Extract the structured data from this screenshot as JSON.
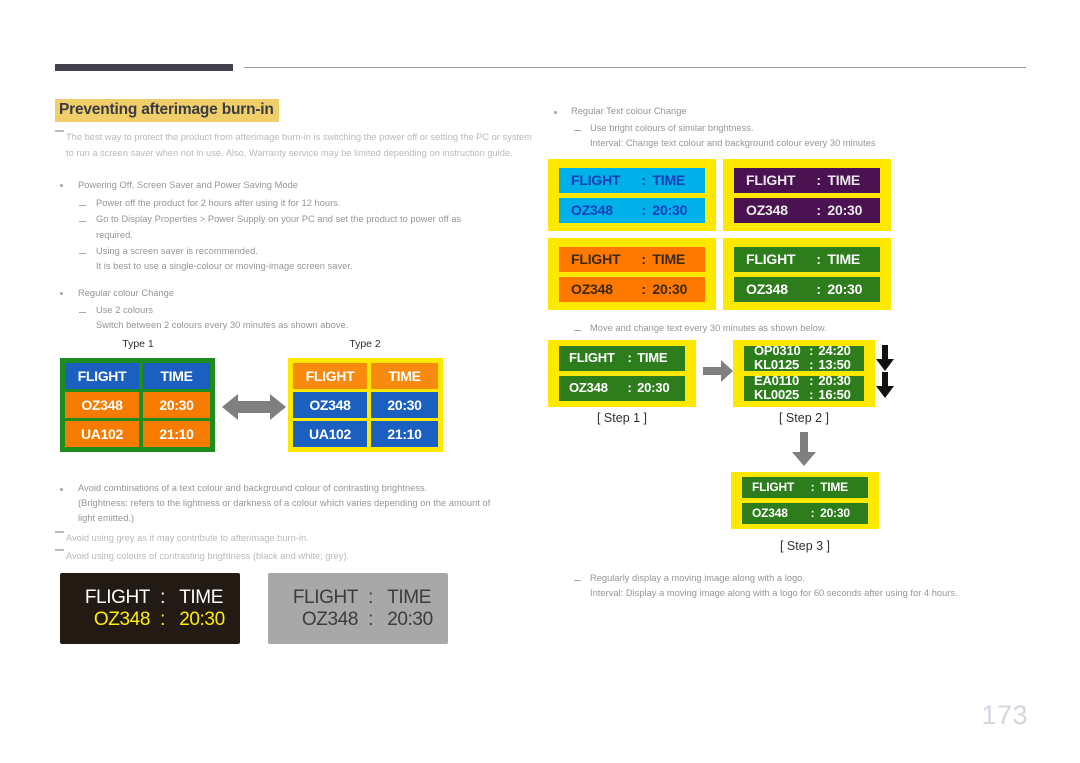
{
  "header": {
    "accent_color": "#45414f",
    "rule_color": "#9a9aa0"
  },
  "title": "Preventing afterimage burn-in",
  "title_highlight_color": "#f0cf6a",
  "left_column": {
    "intro_note": "The best way to protect the product from afterimage burn-in is switching the power off or setting the PC or system to run a screen saver when not in use. Also, Warranty service may be limited depending on instruction guide.",
    "bullet1": "Powering Off, Screen Saver and Power Saving Mode",
    "b1_sub1": "Power off the product for 2 hours after using it for 12 hours.",
    "b1_sub2": "Go to Display Properties > Power Supply on your PC and set the product to power off as required.",
    "b1_sub3": "Using a screen saver is recommended.",
    "b1_sub3_cont": "It is best to use a single-colour or moving-image screen saver.",
    "bullet2": "Regular colour Change",
    "b2_sub1": "Use 2 colours",
    "b2_sub1_cont": "Switch between 2 colours every 30 minutes as shown above.",
    "bullet3": "Avoid combinations of a text colour and background colour of contrasting brightness.",
    "bullet3_cont1": "(Brightness: refers to the lightness or darkness of a colour which varies depending on the amount of",
    "bullet3_cont2": "light emitted.)",
    "note1": "Avoid using grey as it may contribute to afterimage burn-in.",
    "note2": "Avoid using colours of contrasting brightness (black and white; grey)."
  },
  "right_column": {
    "bullet1": "Regular Text colour Change",
    "b1_sub1": "Use bright colours of similar brightness.",
    "b1_sub1_cont": "Interval: Change text colour and background colour every 30 minutes",
    "b1_sub2": "Move and change text every 30 minutes as shown below.",
    "b1_sub3": "Regularly display a moving image along with a logo.",
    "b1_sub3_cont": "Interval: Display a moving image along with a logo for 60 seconds after using for 4 hours."
  },
  "type_boards": [
    {
      "label": "Type 1",
      "border_color": "#1e8c1e",
      "header_bg": "#1b5fc0",
      "header_fg": "#ffffff",
      "body_bg": "#f57c00",
      "body_fg": "#ffffff",
      "rows": [
        [
          "FLIGHT",
          "TIME"
        ],
        [
          "OZ348",
          "20:30"
        ],
        [
          "UA102",
          "21:10"
        ]
      ]
    },
    {
      "label": "Type 2",
      "border_color": "#ffe800",
      "header_bg": "#f88a10",
      "header_fg": "#ffffff",
      "body_bg": "#1b5fc0",
      "body_fg": "#ffffff",
      "rows": [
        [
          "FLIGHT",
          "TIME"
        ],
        [
          "OZ348",
          "20:30"
        ],
        [
          "UA102",
          "21:10"
        ]
      ]
    }
  ],
  "swap_arrow": "double-headed-horizontal-arrow",
  "colour_panels": [
    {
      "name": "cyan-panel",
      "frame": "#ffe800",
      "bg": "#00b0e8",
      "fg": "#1540b8",
      "flight_label": "FLIGHT",
      "time_label": "TIME",
      "separator": ":",
      "flight_no": "OZ348",
      "flight_time": "20:30"
    },
    {
      "name": "purple-panel",
      "frame": "#ffe800",
      "bg": "#4b1252",
      "fg": "#e8e8e8",
      "flight_label": "FLIGHT",
      "time_label": "TIME",
      "separator": ":",
      "flight_no": "OZ348",
      "flight_time": "20:30"
    },
    {
      "name": "orange-panel",
      "frame": "#ffe800",
      "bg": "#ff7800",
      "fg": "#3a2a10",
      "flight_label": "FLIGHT",
      "time_label": "TIME",
      "separator": ":",
      "flight_no": "OZ348",
      "flight_time": "20:30"
    },
    {
      "name": "green-panel",
      "frame": "#ffe800",
      "bg": "#2d7d1c",
      "fg": "#ffffff",
      "flight_label": "FLIGHT",
      "time_label": "TIME",
      "separator": ":",
      "flight_no": "OZ348",
      "flight_time": "20:30"
    }
  ],
  "steps": {
    "step1": {
      "caption": "[ Step 1 ]",
      "frame": "#ffe800",
      "bg": "#2d7d1c",
      "fg": "#ffffff",
      "line1": {
        "left": "FLIGHT",
        "sep": ":",
        "right": "TIME"
      },
      "line2": {
        "left": "OZ348",
        "sep": ":",
        "right": "20:30"
      }
    },
    "step2": {
      "caption": "[ Step 2 ]",
      "frame": "#ffe800",
      "bg": "#2d7d1c",
      "fg": "#ffffff",
      "bar1_top": {
        "left": "OP0310",
        "sep": ":",
        "right": "24:20"
      },
      "bar1_bottom": {
        "left": "KL0125",
        "sep": ":",
        "right": "13:50"
      },
      "bar2_top": {
        "left": "EA0110",
        "sep": ":",
        "right": "20:30"
      },
      "bar2_bottom": {
        "left": "KL0025",
        "sep": ":",
        "right": "16:50"
      }
    },
    "step3": {
      "caption": "[ Step 3 ]",
      "frame": "#ffe800",
      "bg": "#2d7d1c",
      "fg": "#ffffff",
      "line1": {
        "left": "FLIGHT",
        "sep": ":",
        "right": "TIME"
      },
      "line2": {
        "left": "OZ348",
        "sep": ":",
        "right": "20:30"
      }
    }
  },
  "mono_panels": [
    {
      "name": "dark-panel",
      "bg": "#231a14",
      "header_fg": "#ffffff",
      "value_fg": "#ffee00",
      "line1": {
        "left": "FLIGHT",
        "sep": ":",
        "right": "TIME"
      },
      "line2": {
        "left": "OZ348",
        "sep": ":",
        "right": "20:30"
      }
    },
    {
      "name": "grey-panel",
      "bg": "#a8a8a8",
      "header_fg": "#3c3c3c",
      "value_fg": "#3c3c3c",
      "line1": {
        "left": "FLIGHT",
        "sep": ":",
        "right": "TIME"
      },
      "line2": {
        "left": "OZ348",
        "sep": ":",
        "right": "20:30"
      }
    }
  ],
  "page_number": "173"
}
